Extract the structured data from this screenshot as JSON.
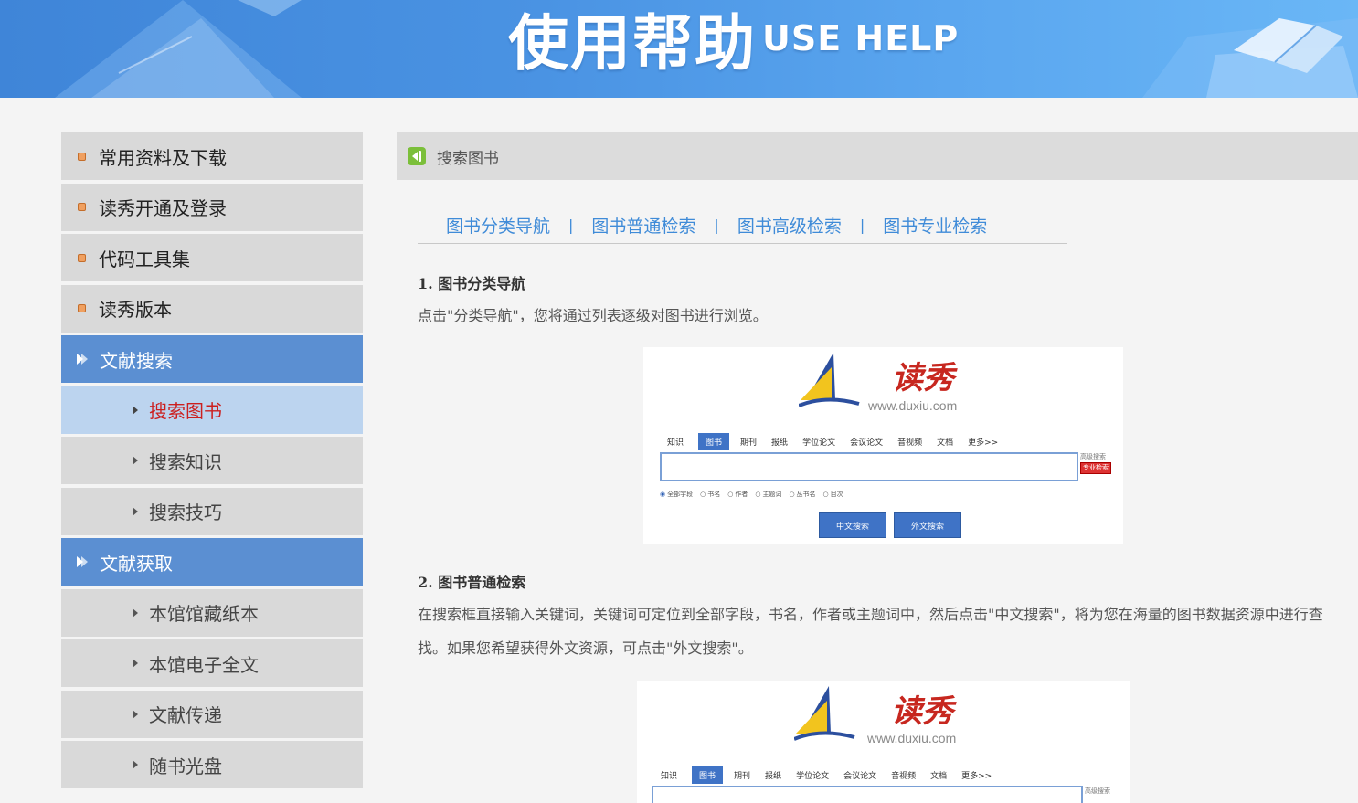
{
  "banner": {
    "title": "使用帮助",
    "subtitle": "USE HELP"
  },
  "sidebar": {
    "items": [
      {
        "label": "常用资料及下载",
        "kind": "top"
      },
      {
        "label": "读秀开通及登录",
        "kind": "top"
      },
      {
        "label": "代码工具集",
        "kind": "top"
      },
      {
        "label": "读秀版本",
        "kind": "top"
      },
      {
        "label": "文献搜索",
        "kind": "section"
      },
      {
        "label": "搜索图书",
        "kind": "sub",
        "active": true
      },
      {
        "label": "搜索知识",
        "kind": "sub"
      },
      {
        "label": "搜索技巧",
        "kind": "sub"
      },
      {
        "label": "文献获取",
        "kind": "section"
      },
      {
        "label": "本馆馆藏纸本",
        "kind": "sub"
      },
      {
        "label": "本馆电子全文",
        "kind": "sub"
      },
      {
        "label": "文献传递",
        "kind": "sub"
      },
      {
        "label": "随书光盘",
        "kind": "sub"
      }
    ]
  },
  "main": {
    "heading": "搜索图书",
    "tabs": [
      "图书分类导航",
      "图书普通检索",
      "图书高级检索",
      "图书专业检索"
    ],
    "tab_separator": "|",
    "sections": [
      {
        "title": "1. 图书分类导航",
        "text": "点击\"分类导航\"，您将通过列表逐级对图书进行浏览。"
      },
      {
        "title": "2. 图书普通检索",
        "text": "在搜索框直接输入关键词，关键词可定位到全部字段，书名，作者或主题词中，然后点击\"中文搜索\"，将为您在海量的图书数据资源中进行查找。如果您希望获得外文资源，可点击\"外文搜索\"。"
      }
    ],
    "screenshot": {
      "logo_text": "读秀",
      "logo_url": "www.duxiu.com",
      "nav": [
        "知识",
        "图书",
        "期刊",
        "报纸",
        "学位论文",
        "会议论文",
        "音视频",
        "文档",
        "更多>>"
      ],
      "nav_active": "图书",
      "side_links": [
        "高级搜索",
        "专业检索"
      ],
      "radios": [
        "全部字段",
        "书名",
        "作者",
        "主题词",
        "丛书名",
        "目次"
      ],
      "buttons": [
        "中文搜索",
        "外文搜索"
      ]
    }
  },
  "colors": {
    "accent": "#3f8bd8",
    "section_bg": "#5b8fd2",
    "active_bg": "#bcd4ef",
    "active_text": "#cc1f1f"
  }
}
